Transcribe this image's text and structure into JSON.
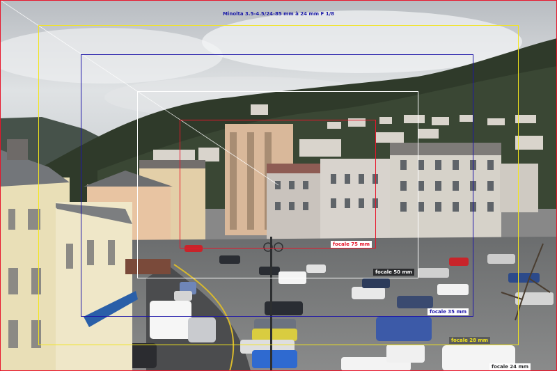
{
  "title": "Minolta 3.5-4.5/24-85 mm à 24 mm F 1/8",
  "frames": [
    {
      "id": "24",
      "label": "focale 24 mm",
      "color": "#e8152a"
    },
    {
      "id": "28",
      "label": "focale 28 mm",
      "color": "#f2e51c"
    },
    {
      "id": "35",
      "label": "focale 35 mm",
      "color": "#1d15a8"
    },
    {
      "id": "50",
      "label": "focale 50 mm",
      "color": "#ffffff"
    },
    {
      "id": "75",
      "label": "focale 75 mm",
      "color": "#e8152a"
    }
  ],
  "colors": {
    "title_text": "#1a1aa8",
    "sky": "#c9cdd1",
    "hill": "#2f3a2a"
  }
}
